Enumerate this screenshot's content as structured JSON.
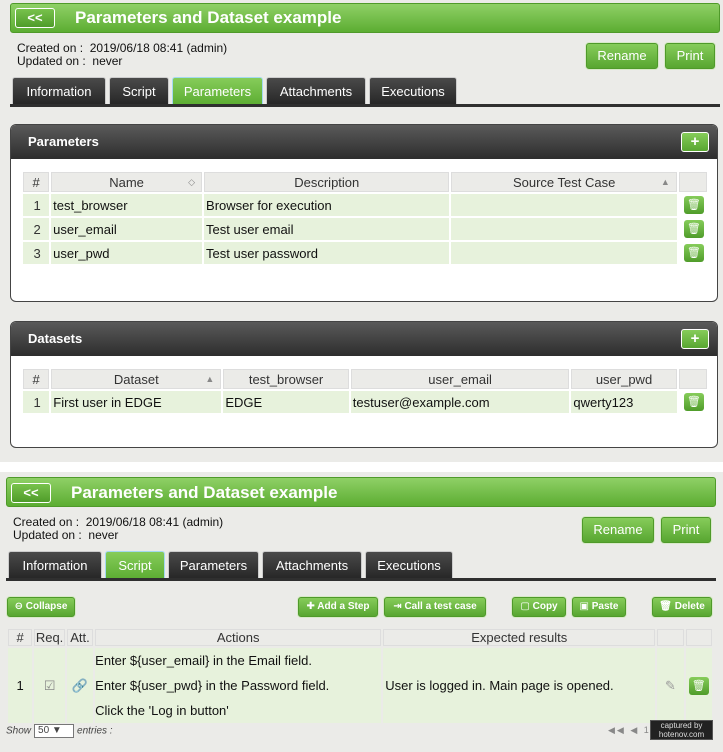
{
  "top": {
    "back_label": "<<",
    "title": "Parameters and Dataset example",
    "created_label": "Created on :",
    "created_value": "2019/06/18 08:41 (admin)",
    "updated_label": "Updated on :",
    "updated_value": "never",
    "rename_label": "Rename",
    "print_label": "Print",
    "tabs": [
      {
        "label": "Information"
      },
      {
        "label": "Script"
      },
      {
        "label": "Parameters"
      },
      {
        "label": "Attachments"
      },
      {
        "label": "Executions"
      }
    ],
    "active_tab": "Parameters",
    "parameters": {
      "title": "Parameters",
      "add_label": "+",
      "columns": [
        "#",
        "Name",
        "Description",
        "Source Test Case"
      ],
      "rows": [
        {
          "num": "1",
          "name": "test_browser",
          "description": "Browser for execution",
          "source": ""
        },
        {
          "num": "2",
          "name": "user_email",
          "description": "Test user email",
          "source": ""
        },
        {
          "num": "3",
          "name": "user_pwd",
          "description": "Test user password",
          "source": ""
        }
      ]
    },
    "datasets": {
      "title": "Datasets",
      "add_label": "+",
      "columns": [
        "#",
        "Dataset",
        "test_browser",
        "user_email",
        "user_pwd"
      ],
      "rows": [
        {
          "num": "1",
          "dataset": "First user in EDGE",
          "test_browser": "EDGE",
          "user_email": "testuser@example.com",
          "user_pwd": "qwerty123"
        }
      ]
    }
  },
  "bottom": {
    "back_label": "<<",
    "title": "Parameters and Dataset example",
    "created_label": "Created on :",
    "created_value": "2019/06/18 08:41 (admin)",
    "updated_label": "Updated on :",
    "updated_value": "never",
    "rename_label": "Rename",
    "print_label": "Print",
    "tabs": [
      {
        "label": "Information"
      },
      {
        "label": "Script"
      },
      {
        "label": "Parameters"
      },
      {
        "label": "Attachments"
      },
      {
        "label": "Executions"
      }
    ],
    "active_tab": "Script",
    "toolbar": {
      "collapse": "Collapse",
      "add_step": "Add a Step",
      "call_test": "Call a test case",
      "copy": "Copy",
      "paste": "Paste",
      "delete": "Delete"
    },
    "steps": {
      "columns": [
        "#",
        "Req.",
        "Att.",
        "Actions",
        "Expected results"
      ],
      "rows": [
        {
          "num": "1",
          "actions": [
            "Enter ${user_email} in the Email field.",
            "Enter ${user_pwd} in the Password field.",
            "Click the 'Log in button'"
          ],
          "expected": "User is logged in. Main page is opened."
        }
      ]
    },
    "footer": {
      "show_label": "Show",
      "entries_value": "50",
      "entries_label": "entries :"
    },
    "watermark": "captured by\nhotenov.com"
  },
  "colors": {
    "green_accent": "#5cad32",
    "dark_header": "#2d2d2d",
    "row_green": "#e7f2dc",
    "background": "#ebebe8"
  }
}
